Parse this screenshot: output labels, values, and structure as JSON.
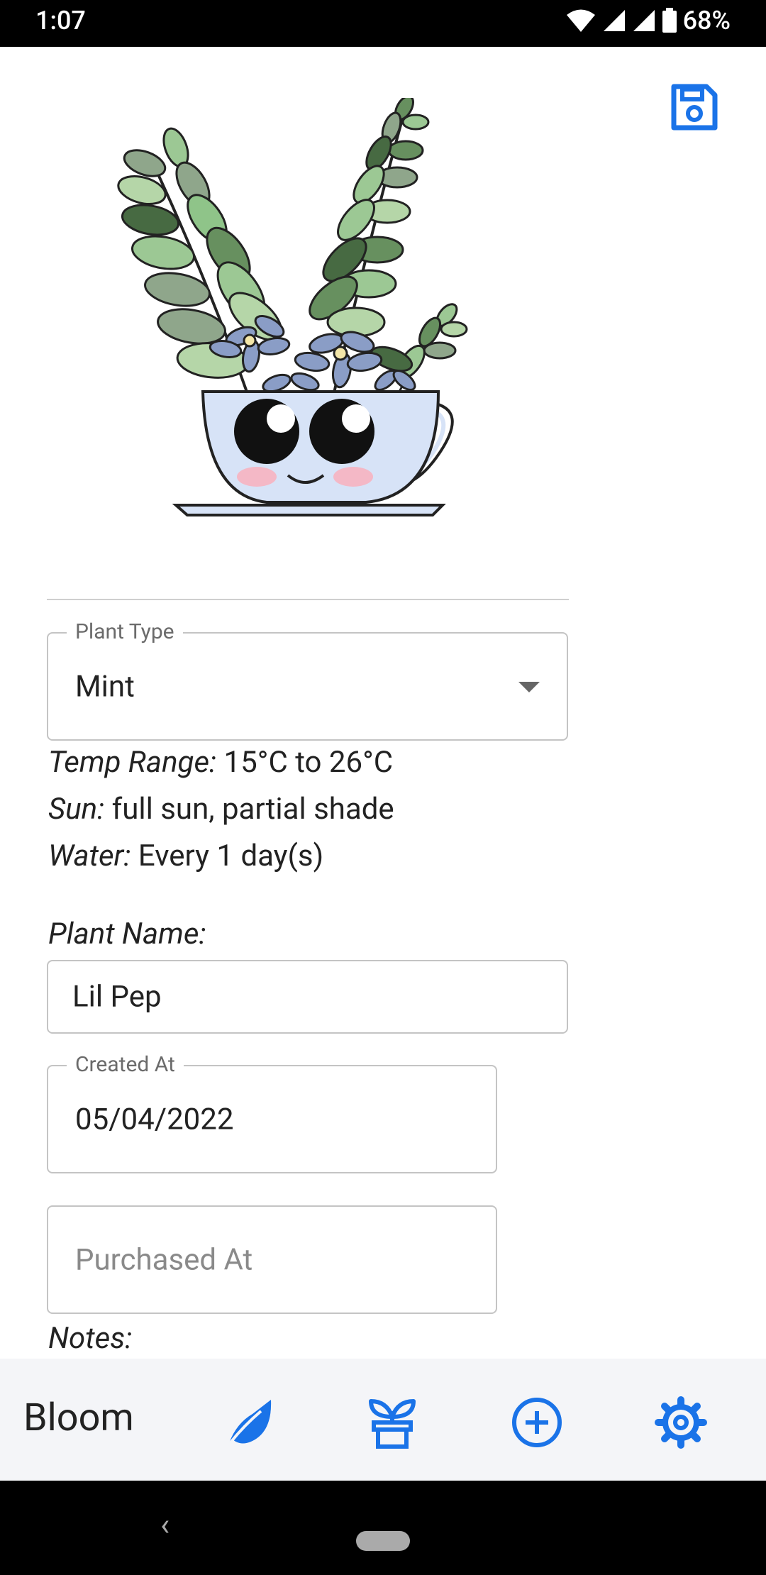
{
  "status_bar": {
    "time": "1:07",
    "battery": "68%"
  },
  "form": {
    "plant_type_label": "Plant Type",
    "plant_type_value": "Mint",
    "temp_label": "Temp Range:",
    "temp_value": "15°C to 26°C",
    "sun_label": "Sun:",
    "sun_value": "full sun, partial shade",
    "water_label": "Water:",
    "water_value": "Every 1 day(s)",
    "plant_name_label": "Plant Name:",
    "plant_name_value": "Lil Pep",
    "created_at_label": "Created At",
    "created_at_value": "05/04/2022",
    "purchased_at_placeholder": "Purchased At",
    "notes_label": "Notes:"
  },
  "bottom_nav": {
    "app_name": "Bloom",
    "items": [
      {
        "icon": "leaf-icon"
      },
      {
        "icon": "potted-plant-icon"
      },
      {
        "icon": "add-circle-icon"
      },
      {
        "icon": "settings-gear-icon"
      }
    ]
  },
  "colors": {
    "accent": "#1a73e8"
  }
}
